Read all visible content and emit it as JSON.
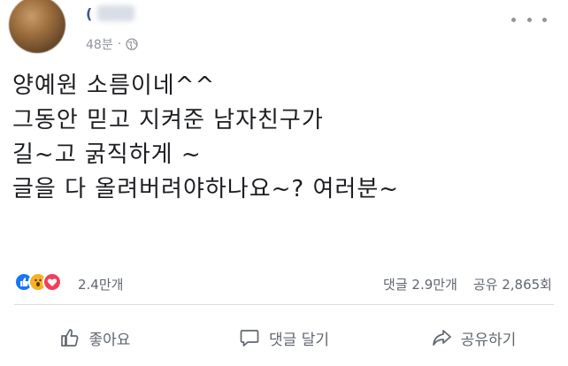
{
  "header": {
    "author_name": "(",
    "time": "48분",
    "separator": "·",
    "privacy_icon": "globe-icon",
    "more_icon": "more-dots-icon"
  },
  "post": {
    "lines": [
      "양예원 소름이네^^",
      "그동안 믿고 지켜준 남자친구가",
      "길~고 굵직하게 ~",
      "글을 다 올려버려야하나요~? 여러분~"
    ]
  },
  "reactions": {
    "icons": [
      "like-reaction-icon",
      "wow-reaction-icon",
      "love-reaction-icon"
    ],
    "count": "2.4만개",
    "comments": "댓글 2.9만개",
    "shares": "공유 2,865회"
  },
  "actions": {
    "like": "좋아요",
    "comment": "댓글 달기",
    "share": "공유하기"
  },
  "colors": {
    "like": "#1877f2",
    "wow": "#f7b125",
    "love": "#f33e58",
    "secondary_text": "#606770",
    "divider": "#dadde1"
  }
}
